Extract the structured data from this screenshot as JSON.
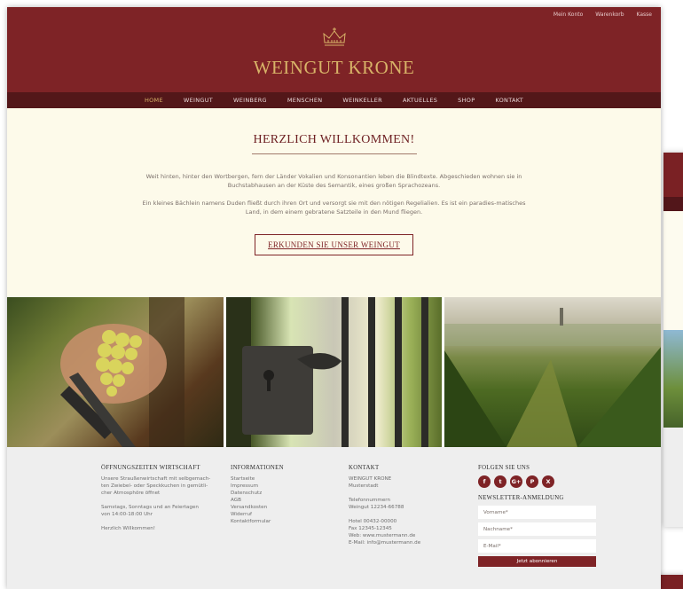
{
  "top_links": [
    "Mein Konto",
    "Warenkorb",
    "Kasse"
  ],
  "brand": "WEINGUT KRONE",
  "nav": [
    {
      "label": "HOME",
      "active": true
    },
    {
      "label": "WEINGUT",
      "active": false
    },
    {
      "label": "WEINBERG",
      "active": false
    },
    {
      "label": "MENSCHEN",
      "active": false
    },
    {
      "label": "WEINKELLER",
      "active": false
    },
    {
      "label": "AKTUELLES",
      "active": false
    },
    {
      "label": "SHOP",
      "active": false
    },
    {
      "label": "KONTAKT",
      "active": false
    }
  ],
  "welcome": {
    "title": "HERZLICH WILLKOMMEN!",
    "paragraph1": "Weit hinten, hinter den Wortbergen, fern der Länder Vokalien und Konsonantien leben die Blindtexte. Abgeschieden wohnen sie in Buchstabhausen an der Küste des Semantik, eines großen Sprachozeans.",
    "paragraph2": "Ein kleines Bächlein namens Duden fließt durch ihren Ort und versorgt sie mit den nötigen Regelialien. Es ist ein paradies-matisches Land, in dem einem gebratene Satzteile in den Mund fliegen.",
    "cta": "ERKUNDEN SIE UNSER WEINGUT"
  },
  "footer": {
    "hours": {
      "title": "ÖFFNUNGSZEITEN WIRTSCHAFT",
      "lines": [
        "Unsere Straußenwirtschaft mit selbgemach-",
        "ten Zwiebel- oder Speckkuchen in gemütli-",
        "cher Atmosphöre öffnet"
      ],
      "lines2": [
        "Samstags, Sonntags und an Feiertagen",
        "von 14:00-18:00 Uhr"
      ],
      "welcome": "Herzlich Willkommen!"
    },
    "info": {
      "title": "INFORMATIONEN",
      "links": [
        "Startseite",
        "Impressum",
        "Datenschutz",
        "AGB",
        "Versandkosten",
        "Widerruf",
        "Kontaktformular"
      ]
    },
    "contact": {
      "title": "KONTAKT",
      "address": [
        "WEINGUT KRONE",
        "Musterstadt"
      ],
      "phone": [
        "Telefonnummern",
        "Weingut 12234-66788"
      ],
      "more": [
        "Hotel 00432-00000",
        "Fax 12345-12345",
        "Web: www.mustermann.de",
        "E-Mail: info@mustermann.de"
      ]
    },
    "follow": {
      "title": "FOLGEN SIE UNS",
      "icons": [
        "f",
        "t",
        "G+",
        "P",
        "X"
      ]
    },
    "newsletter": {
      "title": "NEWSLETTER-ANMELDUNG",
      "firstname_placeholder": "Vorname*",
      "lastname_placeholder": "Nachname*",
      "email_placeholder": "E-Mail*",
      "button": "Jetzt abonnieren"
    }
  },
  "colors": {
    "brand_red": "#7e2326",
    "nav_dark": "#531719",
    "gold": "#d8b368",
    "cream": "#fdfaea",
    "footer_bg": "#eeeeee"
  }
}
